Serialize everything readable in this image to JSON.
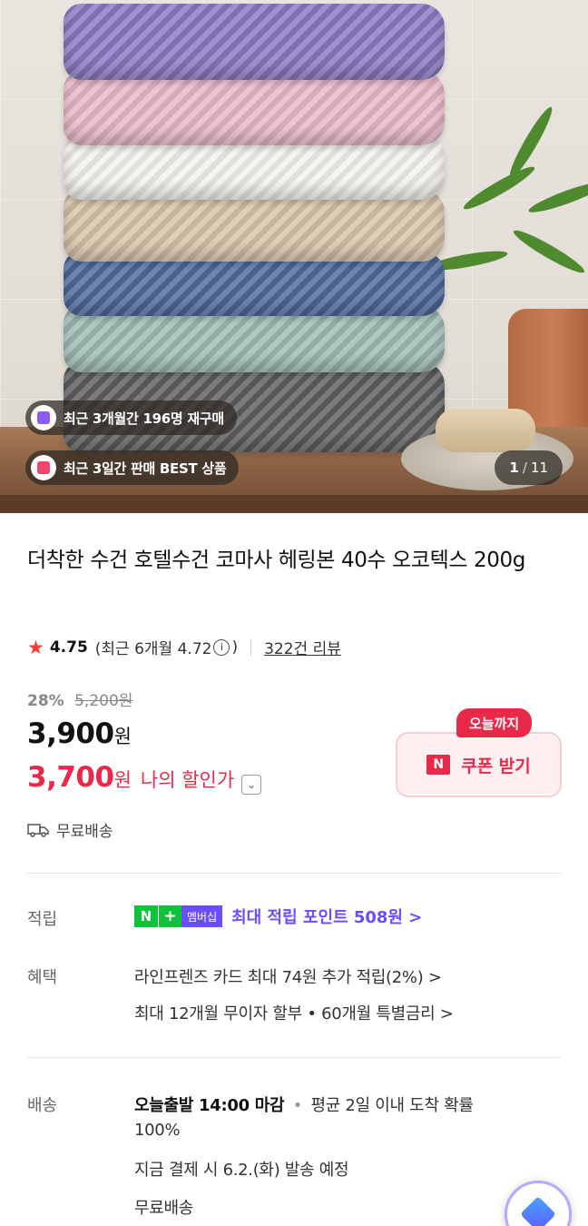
{
  "image": {
    "badges": [
      {
        "label": "최근 3개월간 196명 재구매"
      },
      {
        "label": "최근 3일간 판매 BEST 상품"
      }
    ],
    "counter": {
      "current": "1",
      "total": "11",
      "separator": "/"
    }
  },
  "product": {
    "title": "더착한 수건 호텔수건 코마사 헤링본 40수 오코텍스 200g",
    "rating": {
      "value": "4.75",
      "recent_prefix": "(최근 6개월 4.72",
      "recent_suffix": ")",
      "info_icon": "ⓘ",
      "reviews": "322건 리뷰"
    },
    "pricing": {
      "discount": "28%",
      "original": "5,200원",
      "price": "3,900",
      "price_unit": "원",
      "sale_price": "3,700",
      "sale_unit": "원",
      "sale_label": "나의 할인가"
    },
    "coupon": {
      "tag": "오늘까지",
      "n_mark": "N",
      "label": "쿠폰 받기"
    },
    "shipping_summary": "무료배송"
  },
  "details": {
    "points": {
      "label": "적립",
      "np_n": "N",
      "np_plus": "+",
      "np_membership": "멤버십",
      "text": "최대 적립 포인트 508원 >"
    },
    "benefits": {
      "label": "혜택",
      "lines": [
        "라인프렌즈 카드 최대 74원 추가 적립(2%) >",
        "최대 12개월 무이자 할부 • 60개월 특별금리 >"
      ]
    },
    "delivery": {
      "label": "배송",
      "dispatch_bold": "오늘출발 14:00 마감",
      "dot": "•",
      "dispatch_rest": "평균 2일 이내 도착 확률",
      "dispatch_rest2": "100%",
      "schedule": "지금 결제 시 6.2.(화) 발송 예정",
      "fee": "무료배송"
    }
  },
  "colors": {
    "accent_red": "#e8294a",
    "npay_green": "#10c23a",
    "membership_purple": "#6a4dff"
  }
}
